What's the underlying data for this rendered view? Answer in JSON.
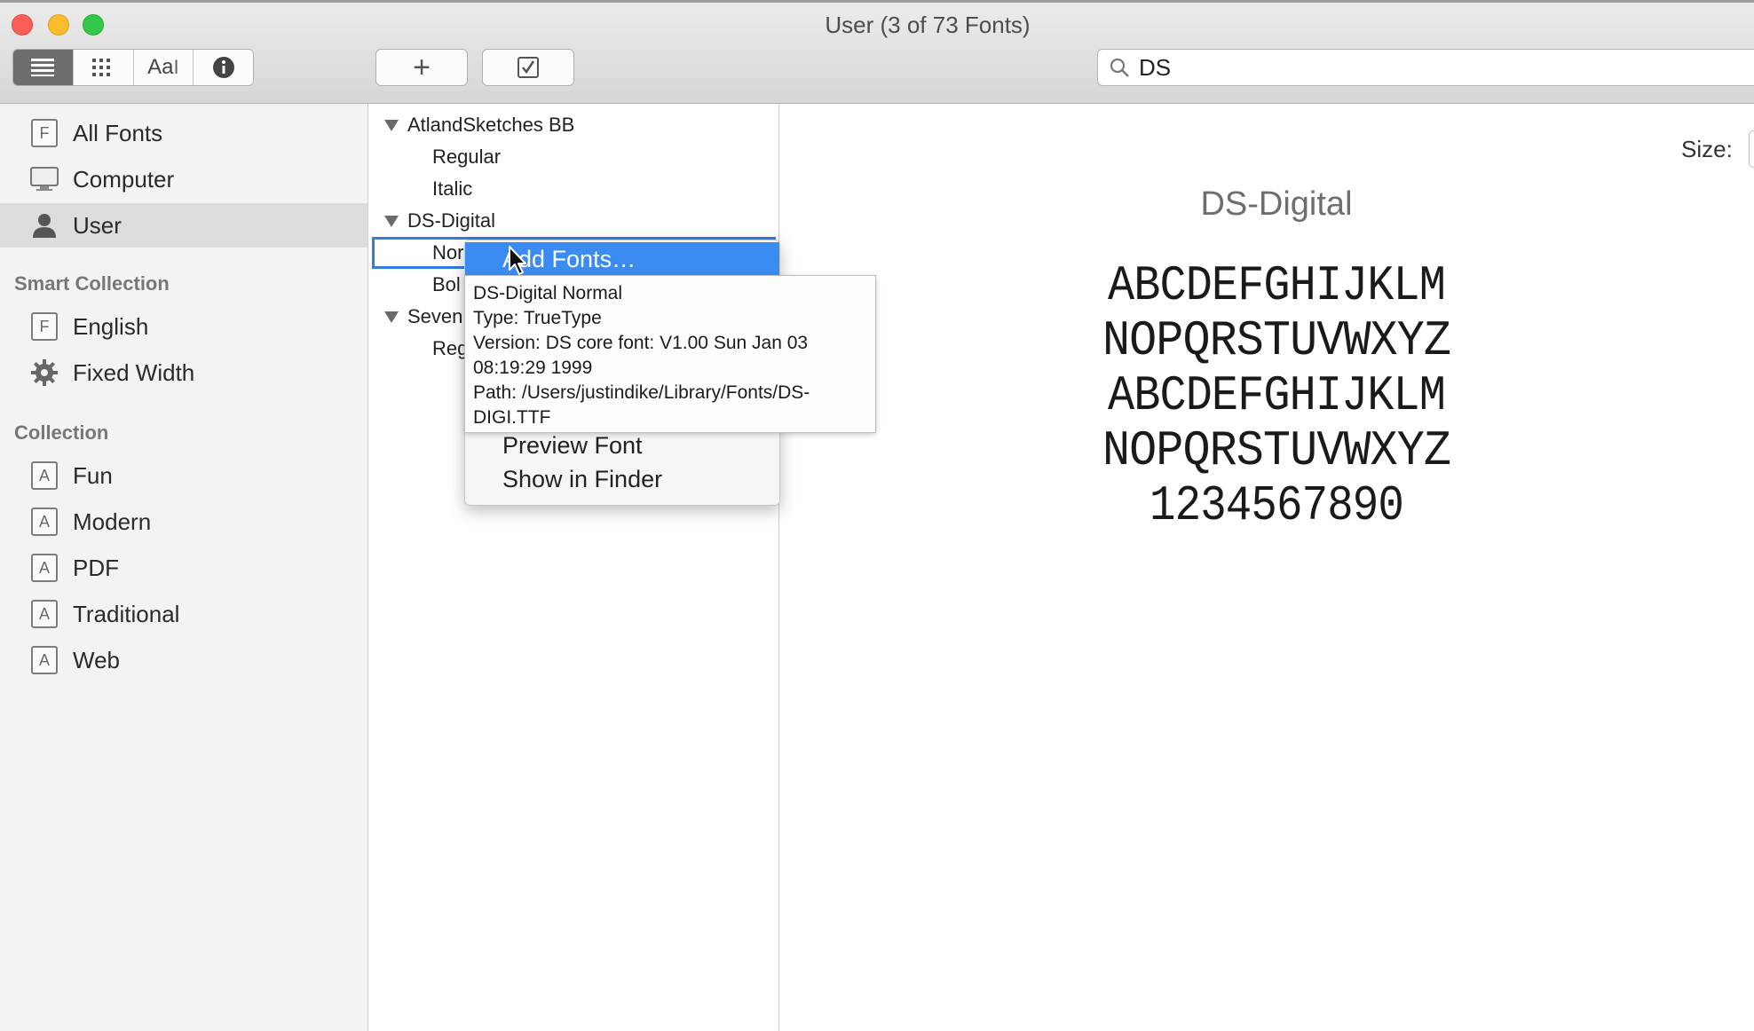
{
  "window": {
    "title": "User (3 of 73 Fonts)"
  },
  "toolbar": {
    "view_buttons": [
      "list-view",
      "grid-view",
      "sample-view",
      "info-view"
    ],
    "sample_label": "Aa",
    "add_label": "+",
    "validate_label": "✓",
    "search": {
      "value": "DS",
      "placeholder": "Search"
    }
  },
  "sidebar": {
    "library": [
      {
        "label": "All Fonts",
        "icon": "font-box-icon",
        "selected": false
      },
      {
        "label": "Computer",
        "icon": "computer-icon",
        "selected": false
      },
      {
        "label": "User",
        "icon": "user-icon",
        "selected": true
      }
    ],
    "smart_collection_header": "Smart Collection",
    "smart_collections": [
      {
        "label": "English",
        "icon": "font-box-icon"
      },
      {
        "label": "Fixed Width",
        "icon": "gear-icon"
      }
    ],
    "collection_header": "Collection",
    "collections": [
      {
        "label": "Fun",
        "icon": "collection-icon"
      },
      {
        "label": "Modern",
        "icon": "collection-icon"
      },
      {
        "label": "PDF",
        "icon": "collection-icon"
      },
      {
        "label": "Traditional",
        "icon": "collection-icon"
      },
      {
        "label": "Web",
        "icon": "collection-icon"
      }
    ],
    "box_letter_f": "F",
    "box_letter_a": "A"
  },
  "font_list": {
    "families": [
      {
        "name": "AtlandSketches BB",
        "styles": [
          "Regular",
          "Italic"
        ]
      },
      {
        "name": "DS-Digital",
        "styles": [
          "Nor",
          "Bol"
        ]
      },
      {
        "name": "Seven",
        "styles": [
          "Reg"
        ]
      }
    ]
  },
  "preview": {
    "size_label": "Size:",
    "font_name": "DS-Digital",
    "sample_lines": [
      "ABCDEFGHIJKLM",
      "NOPQRSTUVWXYZ",
      "ABCDEFGHIJKLM",
      "NOPQRSTUVWXYZ",
      "1234567890"
    ]
  },
  "context_menu": {
    "items": [
      "Add Fonts…",
      "Preview Font",
      "Show in Finder"
    ],
    "highlighted": "Add Fonts…"
  },
  "tooltip": {
    "lines": [
      "DS-Digital Normal",
      "Type: TrueType",
      "Version: DS core font: V1.00 Sun Jan 03",
      "08:19:29 1999",
      "Path: /Users/justindike/Library/Fonts/DS-",
      "DIGI.TTF"
    ]
  }
}
